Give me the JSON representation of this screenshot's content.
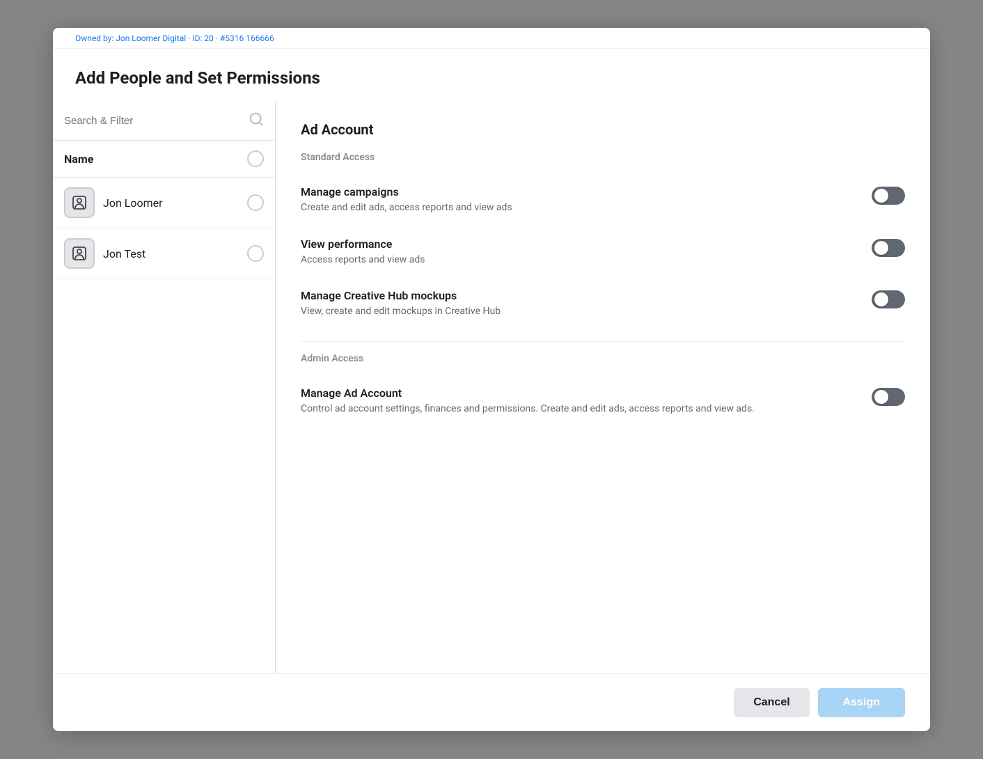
{
  "modal": {
    "title": "Add People and Set Permissions",
    "top_bar_text": "Owned by: Jon Loomer Digital · ID: 20 · #5316 166666"
  },
  "search": {
    "placeholder": "Search & Filter"
  },
  "people_list": {
    "column_header": "Name",
    "items": [
      {
        "id": "jon-loomer",
        "name": "Jon Loomer"
      },
      {
        "id": "jon-test",
        "name": "Jon Test"
      }
    ]
  },
  "permissions": {
    "section_title": "Ad Account",
    "standard_access_label": "Standard Access",
    "admin_access_label": "Admin Access",
    "items": [
      {
        "id": "manage-campaigns",
        "name": "Manage campaigns",
        "desc": "Create and edit ads, access reports and view ads",
        "enabled": false,
        "section": "standard"
      },
      {
        "id": "view-performance",
        "name": "View performance",
        "desc": "Access reports and view ads",
        "enabled": false,
        "section": "standard"
      },
      {
        "id": "manage-creative-hub",
        "name": "Manage Creative Hub mockups",
        "desc": "View, create and edit mockups in Creative Hub",
        "enabled": false,
        "section": "standard"
      },
      {
        "id": "manage-ad-account",
        "name": "Manage Ad Account",
        "desc": "Control ad account settings, finances and permissions. Create and edit ads, access reports and view ads.",
        "enabled": false,
        "section": "admin"
      }
    ]
  },
  "footer": {
    "cancel_label": "Cancel",
    "assign_label": "Assign"
  }
}
